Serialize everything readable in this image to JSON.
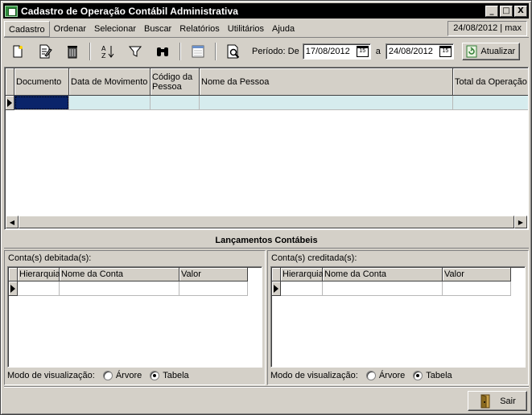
{
  "window": {
    "title": "Cadastro de Operação Contábil Administrativa"
  },
  "title_controls": {
    "minimize": "_",
    "maximize": "□",
    "close": "X"
  },
  "menu": {
    "items": [
      "Cadastro",
      "Ordenar",
      "Selecionar",
      "Buscar",
      "Relatórios",
      "Utilitários",
      "Ajuda"
    ],
    "status": "24/08/2012 | max"
  },
  "toolbar": {
    "icons": [
      "new-document-icon",
      "edit-document-icon",
      "trash-icon",
      "sort-az-icon",
      "filter-icon",
      "binoculars-icon",
      "window-icon",
      "print-preview-icon"
    ],
    "period_label": "Período: De",
    "date_from": "17/08/2012",
    "to_label": "a",
    "date_to": "24/08/2012",
    "calendar_glyph": "15",
    "refresh_label": "Atualizar"
  },
  "main_grid": {
    "columns": [
      "Documento",
      "Data de Movimento",
      "Código da Pessoa",
      "Nome da Pessoa",
      "Total da Operação"
    ],
    "rows": [
      [
        "",
        "",
        "",
        "",
        ""
      ]
    ]
  },
  "section_title": "Lançamentos Contábeis",
  "debit_panel": {
    "label": "Conta(s) debitada(s):",
    "columns": [
      "Hierarquia",
      "Nome da Conta",
      "Valor"
    ],
    "view_mode_label": "Modo de visualização:",
    "options": [
      "Árvore",
      "Tabela"
    ],
    "selected": "Tabela"
  },
  "credit_panel": {
    "label": "Conta(s) creditada(s):",
    "columns": [
      "Hierarquia",
      "Nome da Conta",
      "Valor"
    ],
    "view_mode_label": "Modo de visualização:",
    "options": [
      "Árvore",
      "Tabela"
    ],
    "selected": "Tabela"
  },
  "footer": {
    "exit_label": "Sair"
  },
  "colors": {
    "title_bar": "#000000",
    "selected_row": "#d6ecee",
    "face": "#d4d0c8"
  }
}
